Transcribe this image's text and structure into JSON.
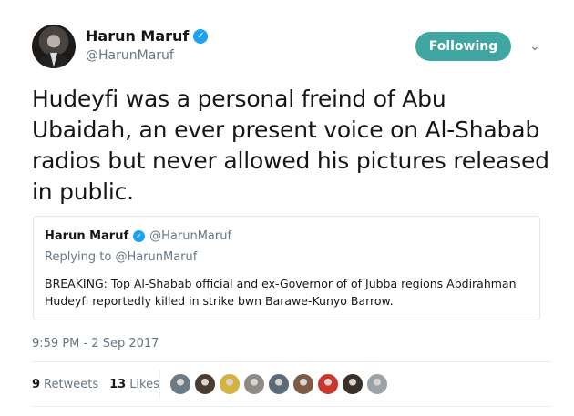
{
  "author": {
    "name": "Harun Maruf",
    "handle": "@HarunMaruf",
    "verified": true
  },
  "follow_button": {
    "label": "Following",
    "color": "#3fa6a2"
  },
  "tweet": {
    "text": "Hudeyfi was a personal freind of Abu Ubaidah, an ever present voice on Al-Shabab radios but never allowed his pictures released in public."
  },
  "quoted_tweet": {
    "name": "Harun Maruf",
    "handle": "@HarunMaruf",
    "replying_prefix": "Replying to",
    "replying_to": "@HarunMaruf",
    "text": "BREAKING: Top Al-Shabab official and ex-Governor of of Jubba regions Abdirahman Hudeyfi reportedly killed in strike bwn Barawe-Kunyo Barrow."
  },
  "timestamp": "9:59 PM - 2 Sep 2017",
  "stats": {
    "retweets_count": "9",
    "retweets_label": "Retweets",
    "likes_count": "13",
    "likes_label": "Likes"
  },
  "likers": [
    {
      "color": "#6b7b86"
    },
    {
      "color": "#4a3c30"
    },
    {
      "color": "#d4b341"
    },
    {
      "color": "#8e8a86"
    },
    {
      "color": "#5a6a78"
    },
    {
      "color": "#7d5b45"
    },
    {
      "color": "#c8362f"
    },
    {
      "color": "#3b2f2a"
    },
    {
      "color": "#9aa3a8"
    }
  ],
  "colors": {
    "verified": "#1da1f2",
    "muted": "#657786",
    "border": "#e1e8ed"
  }
}
